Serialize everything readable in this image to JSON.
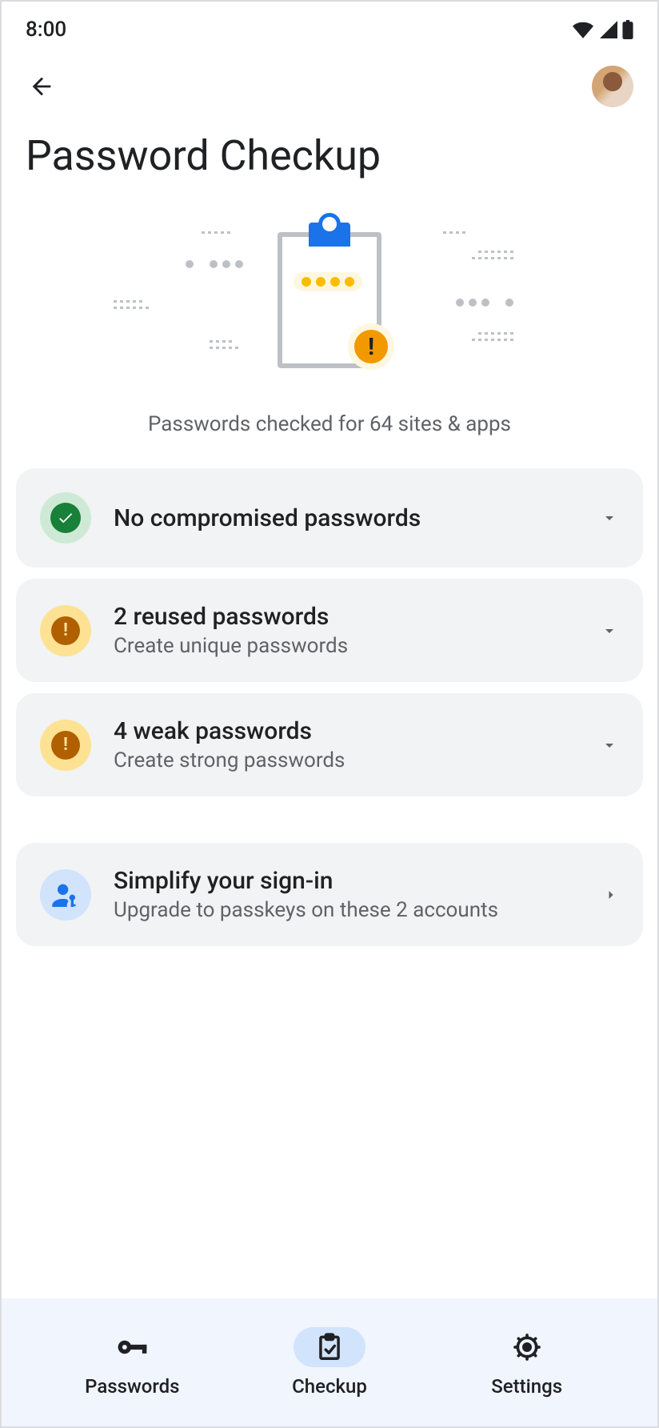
{
  "statusbar": {
    "time": "8:00"
  },
  "header": {
    "title": "Password Checkup"
  },
  "summary": "Passwords checked for 64 sites & apps",
  "cards": {
    "compromised": {
      "title": "No compromised passwords"
    },
    "reused": {
      "title": "2 reused passwords",
      "sub": "Create unique passwords"
    },
    "weak": {
      "title": "4 weak passwords",
      "sub": "Create strong passwords"
    },
    "passkeys": {
      "title": "Simplify your sign-in",
      "sub": "Upgrade to passkeys on these 2 accounts"
    }
  },
  "nav": {
    "passwords": "Passwords",
    "checkup": "Checkup",
    "settings": "Settings"
  }
}
